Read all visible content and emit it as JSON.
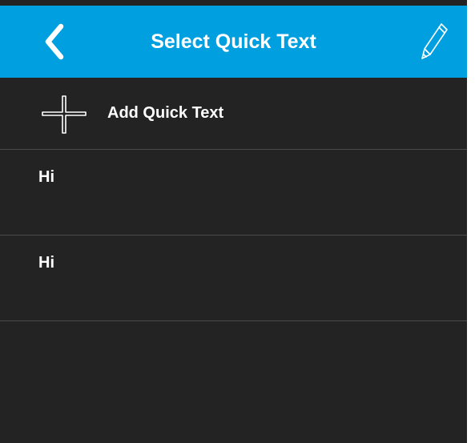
{
  "header": {
    "title": "Select Quick Text",
    "back_icon": "chevron-left-icon",
    "edit_icon": "pencil-icon",
    "background_color": "#009fdf"
  },
  "add_row": {
    "label": "Add Quick Text",
    "icon": "plus-icon"
  },
  "quick_texts": [
    {
      "label": "Hi"
    },
    {
      "label": "Hi"
    }
  ],
  "colors": {
    "background": "#232323",
    "divider": "#4a4a4a",
    "text": "#ffffff"
  }
}
